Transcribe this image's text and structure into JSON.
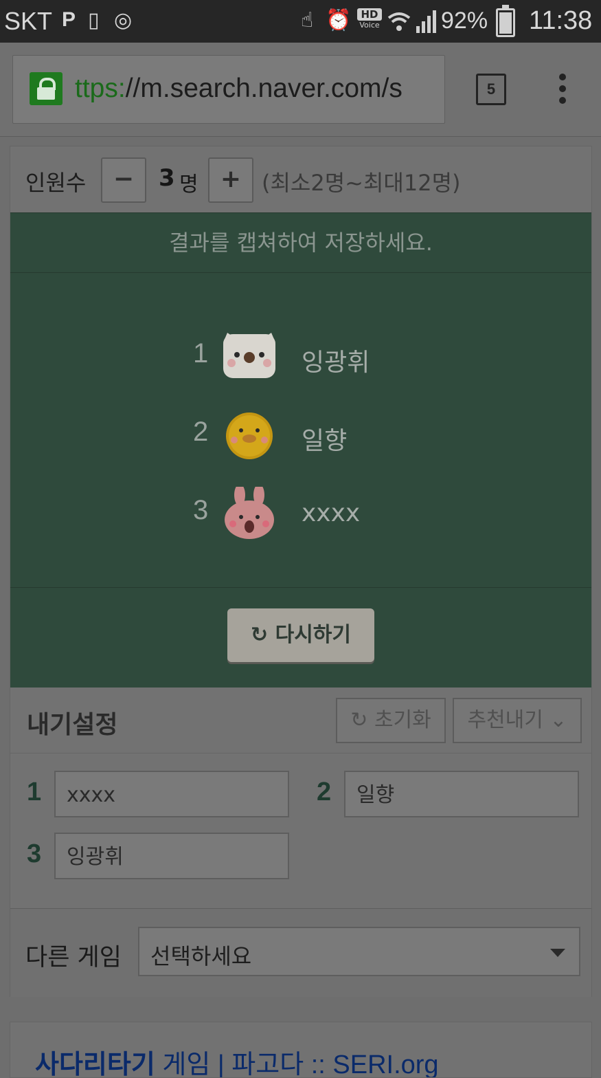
{
  "status_bar": {
    "carrier": "SKT",
    "battery": "92%",
    "time": "11:38",
    "hd_label": "HD",
    "voice_label": "Voice",
    "icons": [
      "p-icon",
      "nfc-icon",
      "instagram-icon",
      "touch-icon",
      "alarm-icon",
      "wifi-icon",
      "signal-icon",
      "battery-icon"
    ]
  },
  "browser": {
    "url_scheme": "ttps:",
    "url_rest": "//m.search.naver.com/s",
    "tab_count": "5"
  },
  "people": {
    "label": "인원수",
    "minus": "−",
    "plus": "+",
    "count": "3",
    "unit": "명",
    "range": "(최소2명~최대12명)"
  },
  "board": {
    "message": "결과를 캡쳐하여 저장하세요.",
    "results": [
      {
        "num": "1",
        "avatar": "white-dog-avatar",
        "name": "잉광휘"
      },
      {
        "num": "2",
        "avatar": "yellow-chick-avatar",
        "name": "일향"
      },
      {
        "num": "3",
        "avatar": "pink-rabbit-avatar",
        "name": "xxxx"
      }
    ],
    "retry_label": "다시하기"
  },
  "settings": {
    "title": "내기설정",
    "reset_label": "초기화",
    "recommend_label": "추천내기",
    "fields": [
      {
        "num": "1",
        "value": "xxxx"
      },
      {
        "num": "2",
        "value": "일향"
      },
      {
        "num": "3",
        "value": "잉광휘"
      }
    ]
  },
  "other_game": {
    "label": "다른 게임",
    "selected": "선택하세요"
  },
  "search_result": {
    "strong": "사다리타기",
    "rest": " 게임 | 파고다 :: SERI.org"
  }
}
